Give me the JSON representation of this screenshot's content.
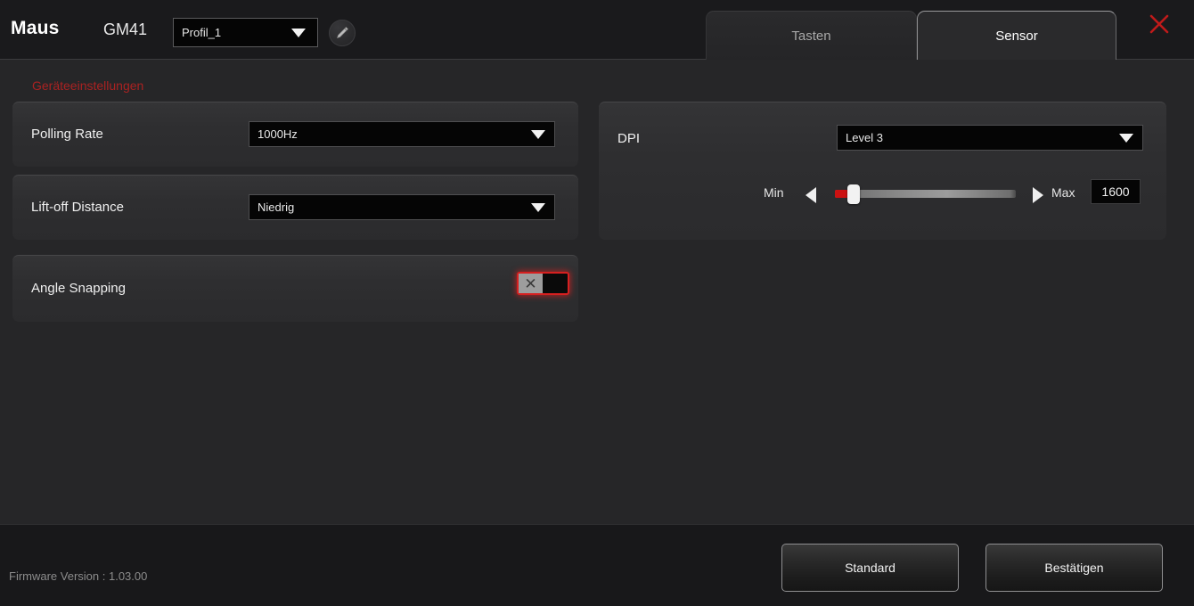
{
  "header": {
    "app_title": "Maus",
    "device_name": "GM41",
    "profile": {
      "value": "Profil_1",
      "caret_icon": "chevron-down-icon"
    },
    "edit_icon": "pencil-icon",
    "close_icon": "close-x-icon",
    "tabs": [
      {
        "id": "tasten",
        "label": "Tasten",
        "active": false
      },
      {
        "id": "sensor",
        "label": "Sensor",
        "active": true
      }
    ]
  },
  "main": {
    "section_title": "Geräteeinstellungen",
    "left_settings": [
      {
        "id": "polling-rate",
        "label": "Polling Rate",
        "control": "dropdown",
        "value": "1000Hz"
      },
      {
        "id": "lift-off-distance",
        "label": "Lift-off Distance",
        "control": "dropdown",
        "value": "Niedrig"
      },
      {
        "id": "angle-snapping",
        "label": "Angle Snapping",
        "control": "toggle",
        "state": "off",
        "knob_glyph": "✕"
      }
    ],
    "dpi": {
      "label": "DPI",
      "level_value": "Level 3",
      "min_label": "Min",
      "max_label": "Max",
      "value": "1600",
      "slider": {
        "position_percent": 10,
        "dec_icon": "arrow-left-icon",
        "inc_icon": "arrow-right-icon"
      }
    }
  },
  "footer": {
    "firmware_text": "Firmware Version : 1.03.00",
    "default_button": "Standard",
    "confirm_button": "Bestätigen"
  },
  "colors": {
    "accent_red": "#aa2222",
    "toggle_red": "#d62020",
    "slider_red": "#cc1111",
    "close_red": "#c01a1a",
    "background": "#262628",
    "header_bg": "#1a1a1c",
    "footer_bg": "#18181a",
    "card_bg": "#2e2e30"
  }
}
